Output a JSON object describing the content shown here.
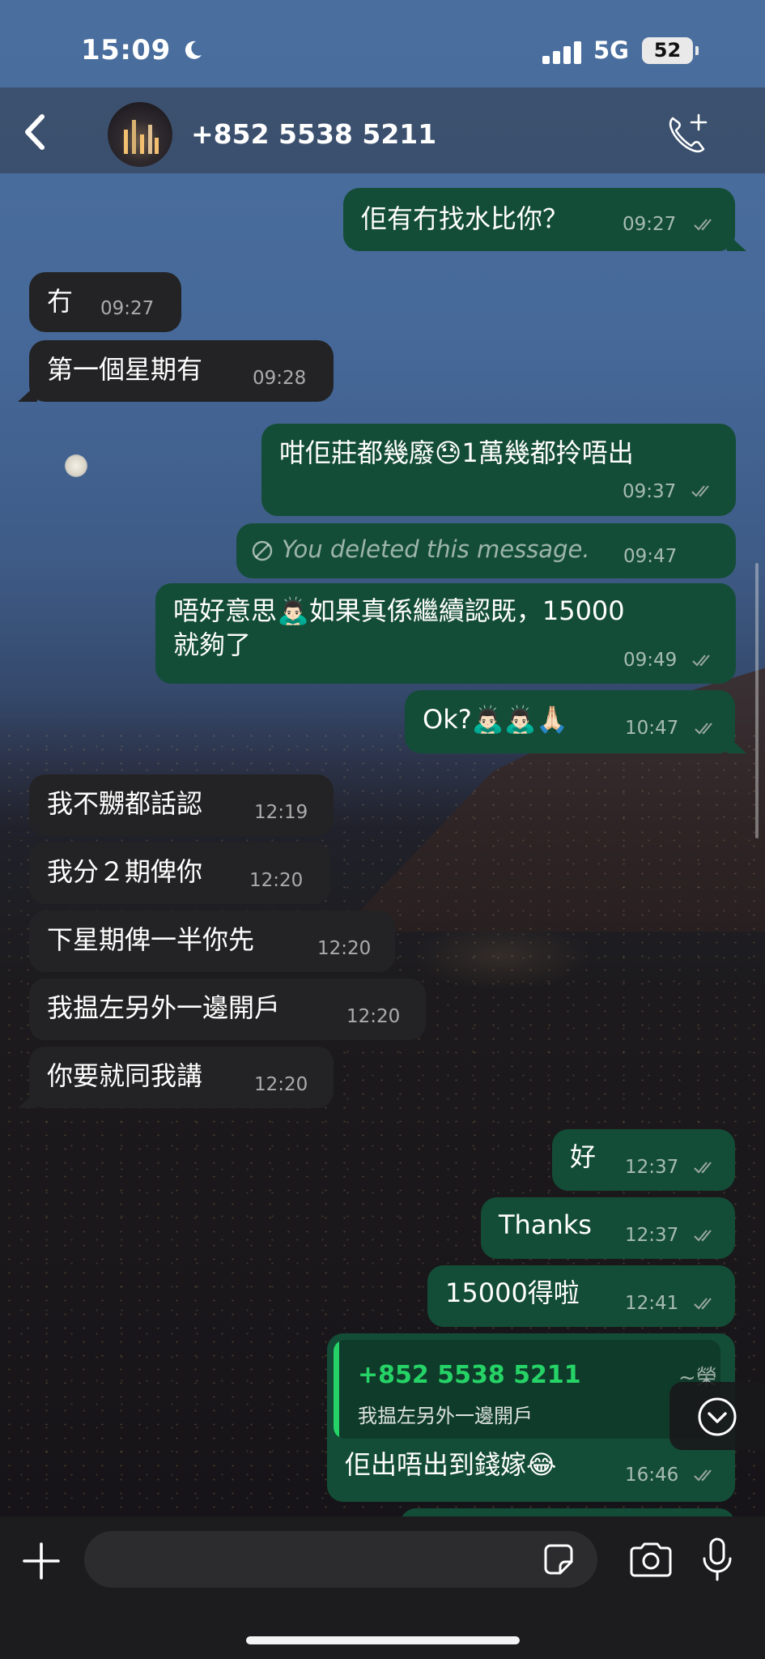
{
  "status_bar": {
    "time": "15:09",
    "network": "5G",
    "battery": "52"
  },
  "header": {
    "contact_name": "+852 5538 5211"
  },
  "messages": [
    {
      "dir": "out",
      "text": "佢有冇找水比你？",
      "time": "09:27"
    },
    {
      "dir": "in",
      "text": "冇",
      "time": "09:27"
    },
    {
      "dir": "in",
      "text": "第一個星期有",
      "time": "09:28"
    },
    {
      "dir": "out",
      "text": "咁佢莊都幾廢😓1萬幾都拎唔出",
      "time": "09:37"
    },
    {
      "dir": "out",
      "text": "You deleted this message.",
      "time": "09:47"
    },
    {
      "dir": "out",
      "text_line1": "唔好意思🙇🏻‍♂️如果真係繼續認既，15000",
      "text_line2": "就夠了",
      "time": "09:49"
    },
    {
      "dir": "out",
      "text": "Ok?🙇🏻‍♂️🙇🏻‍♂️🙏🏻",
      "time": "10:47"
    },
    {
      "dir": "in",
      "text": "我不嬲都話認",
      "time": "12:19"
    },
    {
      "dir": "in",
      "text": "我分２期俾你",
      "time": "12:20"
    },
    {
      "dir": "in",
      "text": "下星期俾一半你先",
      "time": "12:20"
    },
    {
      "dir": "in",
      "text": "我揾左另外一邊開戶",
      "time": "12:20"
    },
    {
      "dir": "in",
      "text": "你要就同我講",
      "time": "12:20"
    },
    {
      "dir": "out",
      "text": "好",
      "time": "12:37"
    },
    {
      "dir": "out",
      "text": "Thanks",
      "time": "12:37"
    },
    {
      "dir": "out",
      "text": "15000得啦",
      "time": "12:41"
    },
    {
      "dir": "out",
      "quote_name": "+852 5538 5211",
      "quote_tag": "~榮",
      "quote_text": "我揾左另外一邊開戶",
      "text": "佢出唔出到錢嫁😂",
      "time": "16:46"
    }
  ],
  "composer": {
    "placeholder": ""
  }
}
